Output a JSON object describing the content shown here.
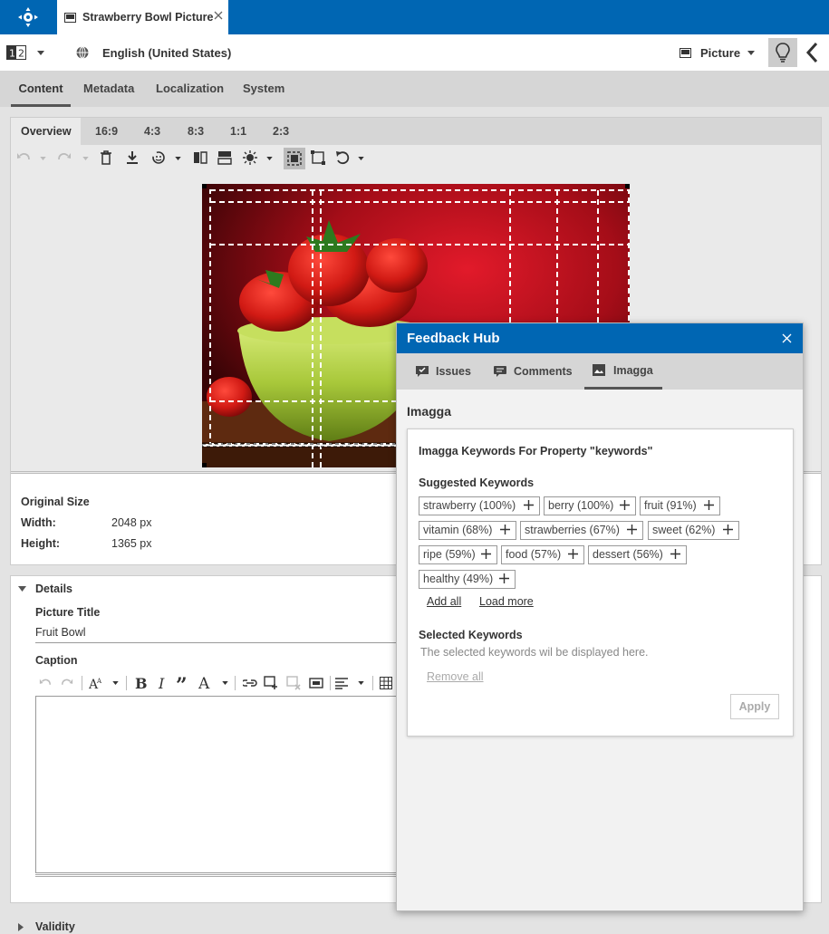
{
  "app": {
    "tab_title": "Strawberry Bowl Picture"
  },
  "toolbar": {
    "locale": "English (United States)",
    "type_label": "Picture"
  },
  "main_tabs": [
    "Content",
    "Metadata",
    "Localization",
    "System"
  ],
  "image_tabs": [
    "Overview",
    "16:9",
    "4:3",
    "8:3",
    "1:1",
    "2:3"
  ],
  "original_size": {
    "title": "Original Size",
    "width_label": "Width:",
    "width_value": "2048 px",
    "height_label": "Height:",
    "height_value": "1365 px"
  },
  "details": {
    "section_label": "Details",
    "picture_title_label": "Picture Title",
    "picture_title_value": "Fruit Bowl",
    "caption_label": "Caption"
  },
  "validity": {
    "label": "Validity"
  },
  "feedback_hub": {
    "title": "Feedback Hub",
    "tabs": [
      "Issues",
      "Comments",
      "Imagga"
    ],
    "section_title": "Imagga",
    "panel_title": "Imagga Keywords For Property \"keywords\"",
    "suggested_label": "Suggested Keywords",
    "keywords": [
      "strawberry (100%)",
      "berry (100%)",
      "fruit (91%)",
      "vitamin (68%)",
      "strawberries (67%)",
      "sweet (62%)",
      "ripe (59%)",
      "food (57%)",
      "dessert (56%)",
      "healthy (49%)"
    ],
    "add_all": "Add all",
    "load_more": "Load more",
    "selected_label": "Selected Keywords",
    "selected_placeholder": "The selected keywords wil be displayed here.",
    "remove_all": "Remove all",
    "apply": "Apply"
  },
  "colors": {
    "brand": "#0066b3",
    "tab_bar": "#d6d6d6",
    "bowl": "#a8c83a",
    "background_red": "#c0101a"
  },
  "icons": [
    "home-compass-icon",
    "picture-icon",
    "close-icon",
    "language-globe-icon",
    "chevron-left-icon",
    "lightbulb-icon",
    "undo-icon",
    "redo-icon",
    "trash-icon",
    "download-icon",
    "face-detect-icon",
    "flip-icon",
    "brightness-icon",
    "crop-icon",
    "rotate-icon",
    "issues-icon",
    "comments-icon",
    "imagga-icon"
  ]
}
